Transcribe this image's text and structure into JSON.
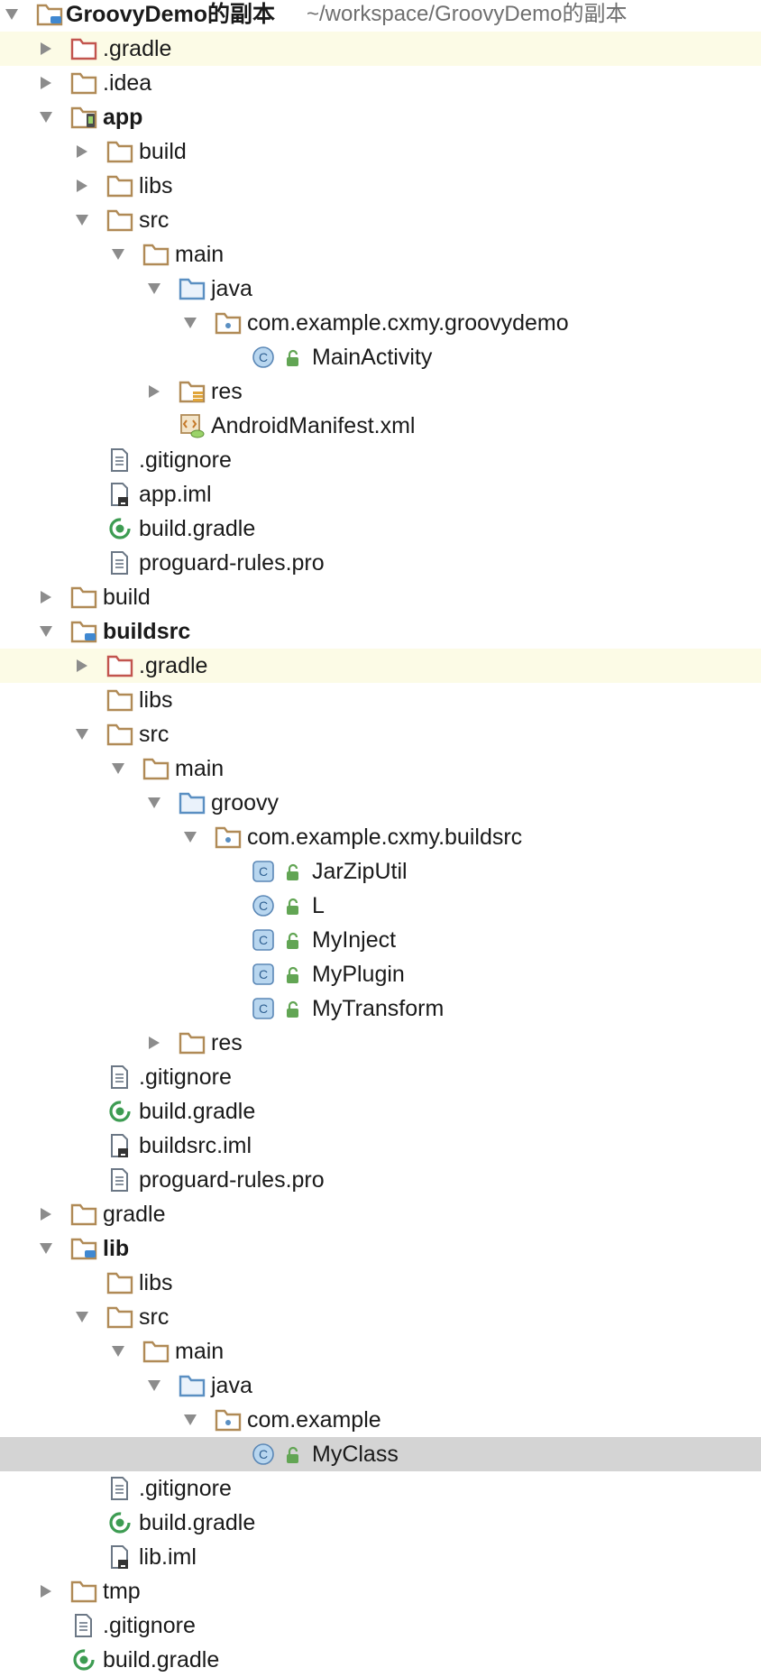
{
  "project_tree": {
    "root": {
      "name": "GroovyDemo的副本",
      "path": "~/workspace/GroovyDemo的副本"
    },
    "items": [
      {
        "label": ".gradle",
        "depth": 1,
        "expander": "collapsed",
        "icon": "gradle-folder-icon",
        "highlight": "yellow"
      },
      {
        "label": ".idea",
        "depth": 1,
        "expander": "collapsed",
        "icon": "folder-icon"
      },
      {
        "label": "app",
        "depth": 1,
        "expander": "expanded",
        "icon": "android-module-icon",
        "bold": true
      },
      {
        "label": "build",
        "depth": 2,
        "expander": "collapsed",
        "icon": "folder-icon"
      },
      {
        "label": "libs",
        "depth": 2,
        "expander": "collapsed",
        "icon": "folder-icon"
      },
      {
        "label": "src",
        "depth": 2,
        "expander": "expanded",
        "icon": "folder-icon"
      },
      {
        "label": "main",
        "depth": 3,
        "expander": "expanded",
        "icon": "folder-icon"
      },
      {
        "label": "java",
        "depth": 4,
        "expander": "expanded",
        "icon": "source-folder-icon"
      },
      {
        "label": "com.example.cxmy.groovydemo",
        "depth": 5,
        "expander": "expanded",
        "icon": "package-icon"
      },
      {
        "label": "MainActivity",
        "depth": 6,
        "expander": "none",
        "icon": "class-icon",
        "lock": true
      },
      {
        "label": "res",
        "depth": 4,
        "expander": "collapsed",
        "icon": "resource-folder-icon"
      },
      {
        "label": "AndroidManifest.xml",
        "depth": 4,
        "expander": "none",
        "icon": "android-manifest-icon"
      },
      {
        "label": ".gitignore",
        "depth": 2,
        "expander": "none",
        "icon": "text-file-icon"
      },
      {
        "label": "app.iml",
        "depth": 2,
        "expander": "none",
        "icon": "iml-file-icon"
      },
      {
        "label": "build.gradle",
        "depth": 2,
        "expander": "none",
        "icon": "gradle-file-icon"
      },
      {
        "label": "proguard-rules.pro",
        "depth": 2,
        "expander": "none",
        "icon": "text-file-icon"
      },
      {
        "label": "build",
        "depth": 1,
        "expander": "collapsed",
        "icon": "folder-icon"
      },
      {
        "label": "buildsrc",
        "depth": 1,
        "expander": "expanded",
        "icon": "module-icon",
        "bold": true
      },
      {
        "label": ".gradle",
        "depth": 2,
        "expander": "collapsed",
        "icon": "gradle-folder-icon",
        "highlight": "yellow"
      },
      {
        "label": "libs",
        "depth": 2,
        "expander": "none",
        "icon": "folder-icon"
      },
      {
        "label": "src",
        "depth": 2,
        "expander": "expanded",
        "icon": "folder-icon"
      },
      {
        "label": "main",
        "depth": 3,
        "expander": "expanded",
        "icon": "folder-icon"
      },
      {
        "label": "groovy",
        "depth": 4,
        "expander": "expanded",
        "icon": "source-folder-icon"
      },
      {
        "label": "com.example.cxmy.buildsrc",
        "depth": 5,
        "expander": "expanded",
        "icon": "package-icon"
      },
      {
        "label": "JarZipUtil",
        "depth": 6,
        "expander": "none",
        "icon": "groovy-class-icon",
        "lock": true
      },
      {
        "label": "L",
        "depth": 6,
        "expander": "none",
        "icon": "class-icon",
        "lock": true
      },
      {
        "label": "MyInject",
        "depth": 6,
        "expander": "none",
        "icon": "groovy-class-icon",
        "lock": true
      },
      {
        "label": "MyPlugin",
        "depth": 6,
        "expander": "none",
        "icon": "groovy-class-icon",
        "lock": true
      },
      {
        "label": "MyTransform",
        "depth": 6,
        "expander": "none",
        "icon": "groovy-class-icon",
        "lock": true
      },
      {
        "label": "res",
        "depth": 4,
        "expander": "collapsed",
        "icon": "folder-icon"
      },
      {
        "label": ".gitignore",
        "depth": 2,
        "expander": "none",
        "icon": "text-file-icon"
      },
      {
        "label": "build.gradle",
        "depth": 2,
        "expander": "none",
        "icon": "gradle-file-icon"
      },
      {
        "label": "buildsrc.iml",
        "depth": 2,
        "expander": "none",
        "icon": "iml-file-icon"
      },
      {
        "label": "proguard-rules.pro",
        "depth": 2,
        "expander": "none",
        "icon": "text-file-icon"
      },
      {
        "label": "gradle",
        "depth": 1,
        "expander": "collapsed",
        "icon": "folder-icon"
      },
      {
        "label": "lib",
        "depth": 1,
        "expander": "expanded",
        "icon": "module-icon",
        "bold": true
      },
      {
        "label": "libs",
        "depth": 2,
        "expander": "none",
        "icon": "folder-icon"
      },
      {
        "label": "src",
        "depth": 2,
        "expander": "expanded",
        "icon": "folder-icon"
      },
      {
        "label": "main",
        "depth": 3,
        "expander": "expanded",
        "icon": "folder-icon"
      },
      {
        "label": "java",
        "depth": 4,
        "expander": "expanded",
        "icon": "source-folder-icon"
      },
      {
        "label": "com.example",
        "depth": 5,
        "expander": "expanded",
        "icon": "package-icon"
      },
      {
        "label": "MyClass",
        "depth": 6,
        "expander": "none",
        "icon": "class-icon",
        "lock": true,
        "highlight": "selected"
      },
      {
        "label": ".gitignore",
        "depth": 2,
        "expander": "none",
        "icon": "text-file-icon"
      },
      {
        "label": "build.gradle",
        "depth": 2,
        "expander": "none",
        "icon": "gradle-file-icon"
      },
      {
        "label": "lib.iml",
        "depth": 2,
        "expander": "none",
        "icon": "iml-file-icon"
      },
      {
        "label": "tmp",
        "depth": 1,
        "expander": "collapsed",
        "icon": "folder-icon"
      },
      {
        "label": ".gitignore",
        "depth": 1,
        "expander": "none",
        "icon": "text-file-icon"
      },
      {
        "label": "build.gradle",
        "depth": 1,
        "expander": "none",
        "icon": "gradle-file-icon"
      }
    ]
  },
  "colors": {
    "folder": "#b08a56",
    "gradle_folder": "#c2544e",
    "source_folder": "#5a8fc2",
    "class_fill": "#b8d6ef",
    "class_stroke": "#5a87b6",
    "lock": "#62a554",
    "gradle_green": "#3d9c52",
    "highlight_yellow": "#fcfbe6",
    "highlight_selected": "#d4d4d4",
    "path_gray": "#6f6f6f"
  }
}
